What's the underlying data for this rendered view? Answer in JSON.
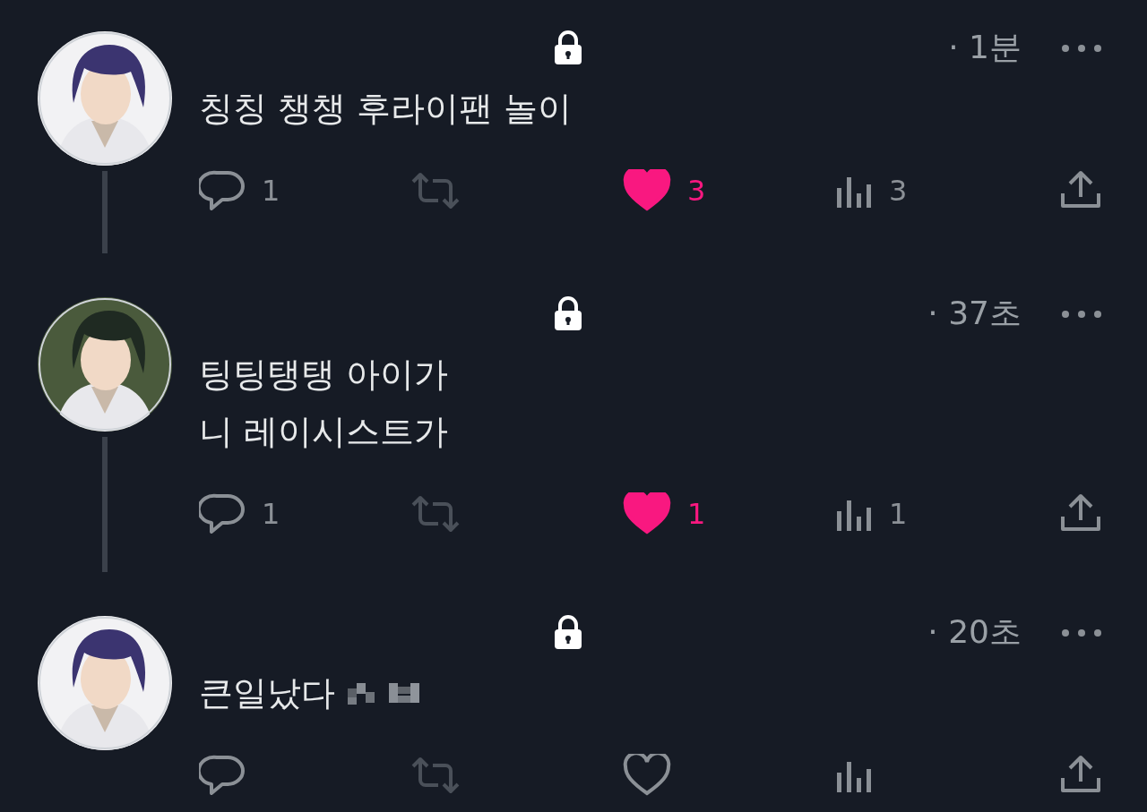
{
  "posts": [
    {
      "locked": true,
      "time": "· 1분",
      "text": "칭칭 챙챙 후라이팬 놀이",
      "censored": false,
      "reply_count": "1",
      "liked": true,
      "like_count": "3",
      "view_count": "3",
      "thread_line": true
    },
    {
      "locked": true,
      "time": "· 37초",
      "text": "팅팅탱탱 아이가\n니 레이시스트가",
      "censored": false,
      "reply_count": "1",
      "liked": true,
      "like_count": "1",
      "view_count": "1",
      "thread_line": true
    },
    {
      "locked": true,
      "time": "· 20초",
      "text": "큰일났다",
      "censored": true,
      "liked": false,
      "thread_line": false
    }
  ]
}
